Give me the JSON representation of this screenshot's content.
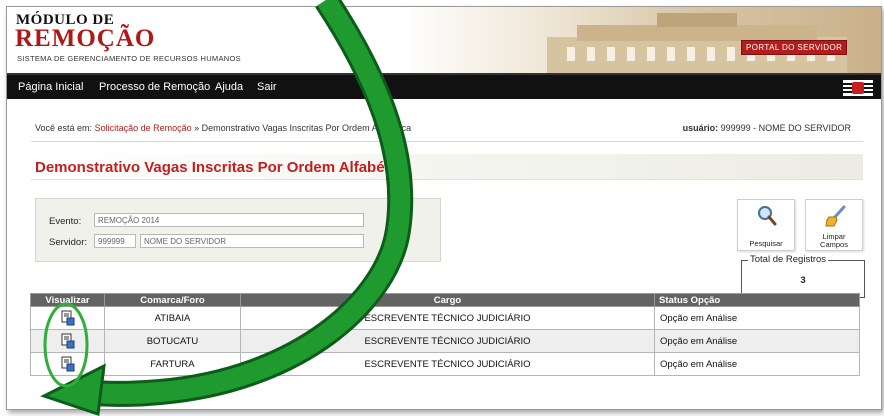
{
  "header": {
    "logo_line1": "MÓDULO DE",
    "logo_line2": "REMOÇÃO",
    "logo_subtitle": "SISTEMA DE GERENCIAMENTO DE RECURSOS HUMANOS",
    "portal_link": "PORTAL DO SERVIDOR"
  },
  "nav": {
    "items": [
      {
        "label": "Página Inicial"
      },
      {
        "label": "Processo de Remoção"
      },
      {
        "label": "Ajuda"
      },
      {
        "label": "Sair"
      }
    ]
  },
  "breadcrumb": {
    "prefix": "Você está em:",
    "link": "Solicitação de Remoção",
    "separator": "»",
    "current": "Demonstrativo Vagas Inscritas Por Ordem Alfabética"
  },
  "user": {
    "label": "usuário:",
    "value": "999999 - NOME DO SERVIDOR"
  },
  "page_title": "Demonstrativo Vagas Inscritas Por Ordem Alfabética",
  "filters": {
    "evento_label": "Evento:",
    "evento_value": "REMOÇÃO 2014",
    "servidor_label": "Servidor:",
    "servidor_id": "999999",
    "servidor_name": "NOME DO SERVIDOR"
  },
  "toolbar": {
    "search_label": "Pesquisar",
    "clear_label_line1": "Limpar",
    "clear_label_line2": "Campos"
  },
  "total": {
    "label": "Total de Registros",
    "value": "3"
  },
  "table": {
    "headers": [
      "Visualizar",
      "Comarca/Foro",
      "Cargo",
      "Status Opção"
    ],
    "rows": [
      {
        "comarca": "ATIBAIA",
        "cargo": "ESCREVENTE TÉCNICO JUDICIÁRIO",
        "status": "Opção em Análise"
      },
      {
        "comarca": "BOTUCATU",
        "cargo": "ESCREVENTE TÉCNICO JUDICIÁRIO",
        "status": "Opção em Análise"
      },
      {
        "comarca": "FARTURA",
        "cargo": "ESCREVENTE TÉCNICO JUDICIÁRIO",
        "status": "Opção em Análise"
      }
    ]
  },
  "colors": {
    "brand_red": "#c41e1e",
    "nav_bg": "#111111",
    "table_header_bg": "#636363",
    "annotation_green": "#1f9a2e"
  },
  "icons": {
    "view": "view-document-icon",
    "search": "magnifier-icon",
    "clear": "broom-icon"
  }
}
